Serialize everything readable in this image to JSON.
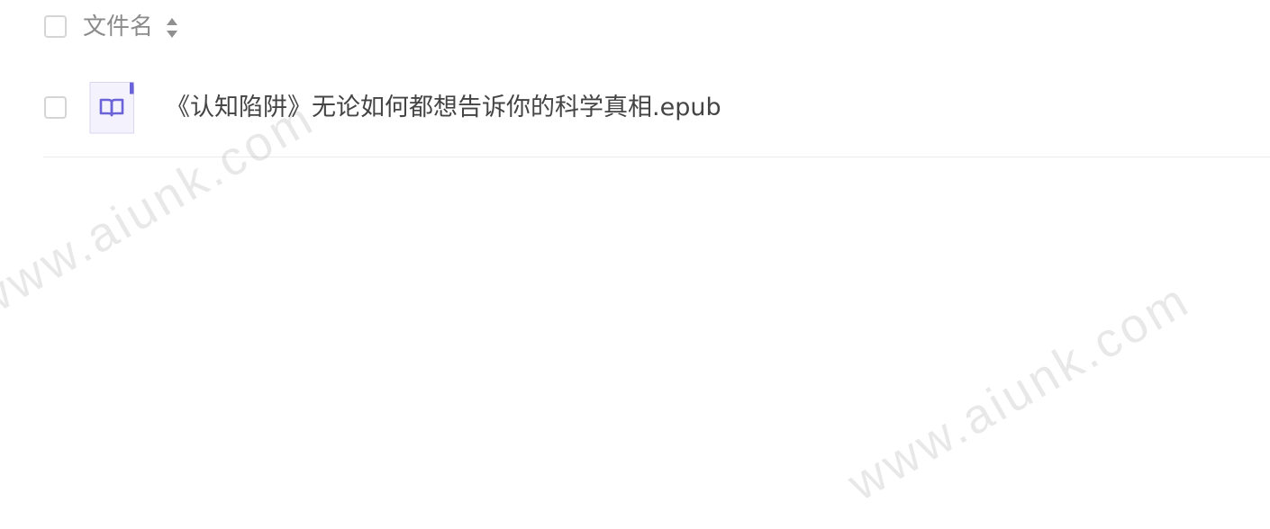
{
  "table": {
    "header": {
      "column_label": "文件名",
      "sort_icon": "sort-icon"
    },
    "rows": [
      {
        "file_name": "《认知陷阱》无论如何都想告诉你的科学真相.epub",
        "file_icon": "epub-book-icon"
      }
    ]
  },
  "watermarks": [
    "www.aiunk.com",
    "www.aiunk.com"
  ],
  "colors": {
    "icon_accent": "#6b63d8",
    "icon_bg": "#f4f2fd",
    "text_primary": "#444444",
    "text_secondary": "#8b8b8b"
  }
}
